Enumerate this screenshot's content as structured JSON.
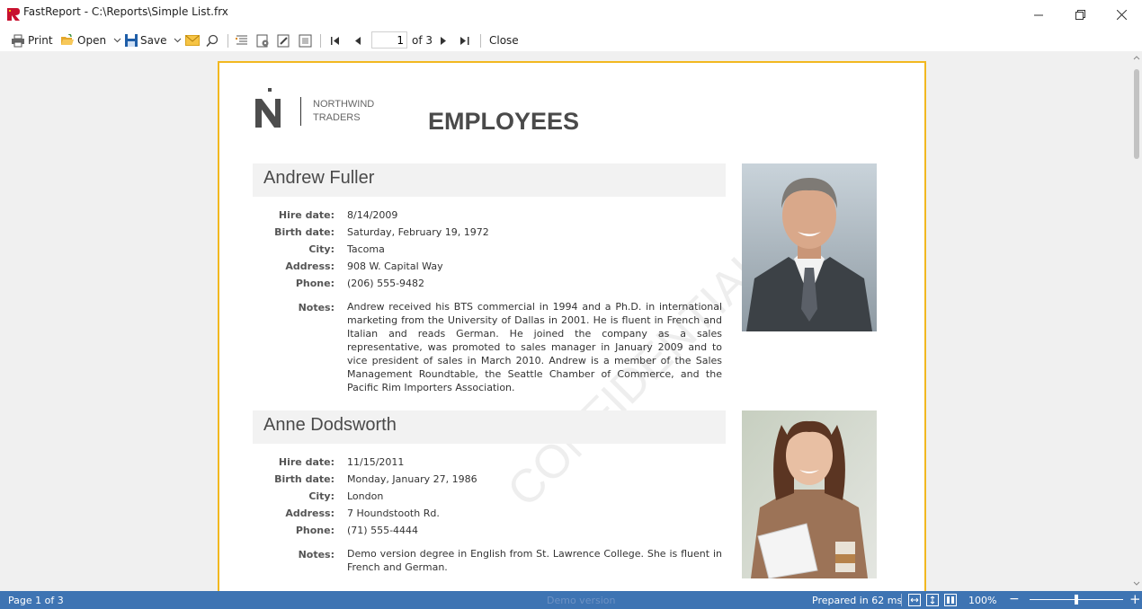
{
  "window": {
    "title": "FastReport - C:\\Reports\\Simple List.frx",
    "app_icon": "fastreport-logo-icon",
    "controls": [
      "minimize-icon",
      "restore-icon",
      "close-icon"
    ]
  },
  "toolbar": {
    "print_label": "Print",
    "open_label": "Open",
    "save_label": "Save",
    "page_value": "1",
    "page_of": "of 3",
    "close_label": "Close"
  },
  "report": {
    "logo_line1": "NORTHWIND",
    "logo_line2": "TRADERS",
    "title": "EMPLOYEES",
    "watermark": "CONFIDENTIAL",
    "labels": {
      "hire_date": "Hire date:",
      "birth_date": "Birth date:",
      "city": "City:",
      "address": "Address:",
      "phone": "Phone:",
      "notes": "Notes:"
    },
    "employees": [
      {
        "name": "Andrew Fuller",
        "hire_date": "8/14/2009",
        "birth_date": "Saturday, February 19, 1972",
        "city": "Tacoma",
        "address": "908 W. Capital Way",
        "phone": "(206) 555-9482",
        "notes": "Andrew received his BTS commercial in 1994 and a Ph.D. in international marketing from the University of Dallas in 2001. He is fluent in French and Italian and reads German. He joined the company as a sales representative, was promoted to sales manager in January 2009 and to vice president of sales in March 2010. Andrew is a member of the Sales Management Roundtable, the Seattle Chamber of Commerce, and the Pacific Rim Importers Association."
      },
      {
        "name": "Anne Dodsworth",
        "hire_date": "11/15/2011",
        "birth_date": "Monday, January 27, 1986",
        "city": "London",
        "address": "7 Houndstooth Rd.",
        "phone": "(71) 555-4444",
        "notes": "Demo version degree in English from St. Lawrence College. She is fluent in French and German."
      }
    ]
  },
  "status": {
    "page_info": "Page 1 of 3",
    "demo": "Demo version",
    "prepared": "Prepared in 62 ms",
    "zoom": "100%",
    "zoom_level_percent": 100,
    "zoom_out": "−",
    "zoom_in": "+"
  },
  "colors": {
    "page_border": "#f2b820",
    "statusbar": "#3e74b3",
    "viewer_bg": "#f0f0f0",
    "header_bg": "#f2f2f2"
  }
}
